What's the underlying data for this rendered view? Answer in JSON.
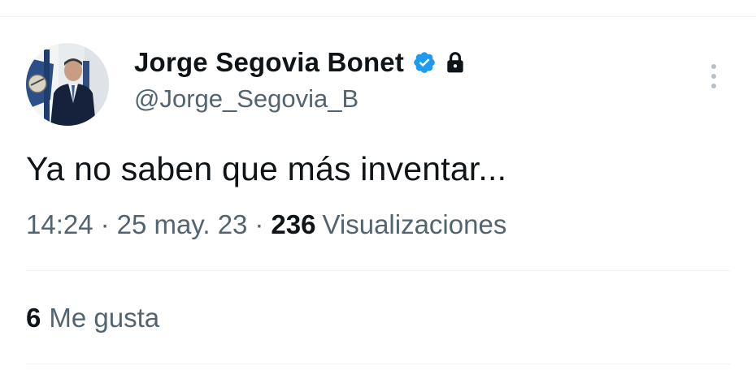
{
  "tweet": {
    "author": {
      "display_name": "Jorge Segovia Bonet",
      "handle": "@Jorge_Segovia_B",
      "verified": true,
      "protected": true,
      "avatar_icon": "profile-photo"
    },
    "text": "Ya no saben que más inventar...",
    "meta": {
      "time": "14:24",
      "separator": "·",
      "date": "25 may. 23",
      "views_count": "236",
      "views_label": "Visualizaciones"
    },
    "likes": {
      "count": "6",
      "label": "Me gusta"
    },
    "colors": {
      "verified_badge": "#1d9bf0",
      "secondary_text": "#536471",
      "primary_text": "#0f1419",
      "divider": "#eff3f4"
    }
  }
}
